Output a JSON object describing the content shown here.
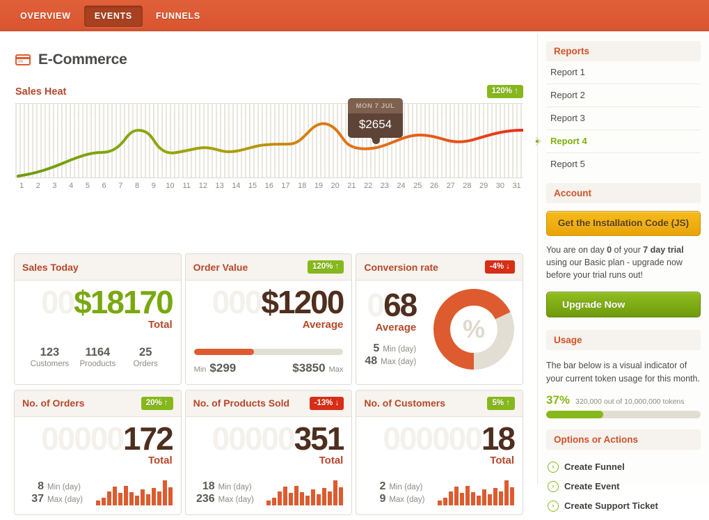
{
  "nav": {
    "tabs": [
      {
        "label": "OVERVIEW",
        "active": false
      },
      {
        "label": "EVENTS",
        "active": true
      },
      {
        "label": "FUNNELS",
        "active": false
      }
    ]
  },
  "page": {
    "title": "E-Commerce",
    "icon": "credit-card-icon"
  },
  "chart_data": {
    "type": "line",
    "title": "Sales Heat",
    "badge": {
      "text": "120% ↑",
      "direction": "up",
      "color": "#86b81b"
    },
    "xlabel": "",
    "ylabel": "",
    "grid": true,
    "legend": "none",
    "categories": [
      "1",
      "2",
      "3",
      "4",
      "5",
      "6",
      "7",
      "8",
      "9",
      "10",
      "11",
      "12",
      "13",
      "14",
      "15",
      "16",
      "17",
      "18",
      "19",
      "20",
      "21",
      "22",
      "23",
      "24",
      "25",
      "26",
      "27",
      "28",
      "29",
      "30",
      "31"
    ],
    "series": [
      {
        "name": "Sales Heat",
        "values": [
          150,
          380,
          640,
          900,
          1150,
          1400,
          1900,
          2300,
          1550,
          1700,
          1900,
          2050,
          1850,
          1900,
          1950,
          2000,
          2100,
          2400,
          3150,
          2450,
          2800,
          2654,
          2900,
          3250,
          3150,
          3000,
          3050,
          3200,
          3300,
          3350,
          3300
        ]
      }
    ],
    "tooltip": {
      "date": "MON 7 JUL",
      "value": "$2654",
      "x_index": 22
    },
    "line_gradient": [
      "#6f9a0d",
      "#a8a50c",
      "#e07b10",
      "#e8571a",
      "#e8231a"
    ]
  },
  "cards": [
    {
      "name": "sales-today",
      "title": "Sales Today",
      "badge": null,
      "ghost": "00",
      "value": "$18170",
      "value_color": "green",
      "value_label": "Total",
      "layout": "stat3",
      "stats": [
        {
          "n": "123",
          "l": "Customers"
        },
        {
          "n": "1164",
          "l": "Prooducts"
        },
        {
          "n": "25",
          "l": "Orders"
        }
      ]
    },
    {
      "name": "order-value",
      "title": "Order Value",
      "badge": {
        "text": "120% ↑",
        "direction": "up"
      },
      "ghost": "000",
      "value": "$1200",
      "value_color": "brown",
      "value_label": "Average",
      "layout": "progress",
      "progress_pct": 40,
      "min_label": "Min",
      "min_value": "$299",
      "max_value": "$3850",
      "max_label": "Max"
    },
    {
      "name": "conversion-rate",
      "title": "Conversion rate",
      "badge": {
        "text": "-4% ↓",
        "direction": "down"
      },
      "ghost": "0",
      "value": "68",
      "value_color": "brown",
      "value_label": "Average",
      "layout": "donut",
      "donut_pct": 68,
      "donut_symbol": "%",
      "min_value": "5",
      "min_label": "Min (day)",
      "max_value": "48",
      "max_label": "Max (day)"
    },
    {
      "name": "no-of-orders",
      "title": "No. of Orders",
      "badge": {
        "text": "20% ↑",
        "direction": "up"
      },
      "ghost": "00000",
      "value": "172",
      "value_color": "brown",
      "value_label": "Total",
      "layout": "spark",
      "min_value": "8",
      "min_label": "Min (day)",
      "max_value": "37",
      "max_label": "Max (day)",
      "spark": [
        20,
        30,
        55,
        75,
        50,
        78,
        52,
        38,
        65,
        45,
        70,
        55,
        100,
        72
      ]
    },
    {
      "name": "no-of-products-sold",
      "title": "No. of Products Sold",
      "badge": {
        "text": "-13% ↓",
        "direction": "down"
      },
      "ghost": "00000",
      "value": "351",
      "value_color": "brown",
      "value_label": "Total",
      "layout": "spark",
      "min_value": "18",
      "min_label": "Min (day)",
      "max_value": "236",
      "max_label": "Max (day)",
      "spark": [
        20,
        30,
        55,
        75,
        50,
        78,
        52,
        38,
        65,
        45,
        70,
        55,
        100,
        72
      ]
    },
    {
      "name": "no-of-customers",
      "title": "No. of Customers",
      "badge": {
        "text": "5% ↑",
        "direction": "up"
      },
      "ghost": "000000",
      "value": "18",
      "value_color": "brown",
      "value_label": "Total",
      "layout": "spark",
      "min_value": "2",
      "min_label": "Min (day)",
      "max_value": "9",
      "max_label": "Max (day)",
      "spark": [
        20,
        30,
        55,
        75,
        50,
        78,
        52,
        38,
        65,
        45,
        70,
        55,
        100,
        72
      ]
    }
  ],
  "sidebar": {
    "reports": {
      "heading": "Reports",
      "items": [
        {
          "label": "Report 1",
          "active": false
        },
        {
          "label": "Report 2",
          "active": false
        },
        {
          "label": "Report 3",
          "active": false
        },
        {
          "label": "Report 4",
          "active": true
        },
        {
          "label": "Report 5",
          "active": false
        }
      ]
    },
    "account": {
      "heading": "Account",
      "install_button": "Get the Installation Code (JS)",
      "trial_text_1": "You are on day ",
      "trial_day": "0",
      "trial_text_2": " of your ",
      "trial_plan": "7 day trial",
      "trial_text_3": " using our Basic plan - upgrade now before your trial runs out!",
      "upgrade_button": "Upgrade Now"
    },
    "usage": {
      "heading": "Usage",
      "description": "The bar below is a visual indicator of your current token usage for this month.",
      "percent_label": "37%",
      "percent": 37,
      "detail": "320,000 out of 10,000,000 tokens"
    },
    "actions": {
      "heading": "Options or Actions",
      "items": [
        {
          "label": "Create Funnel",
          "icon": "chevron-right-circle-icon"
        },
        {
          "label": "Create Event",
          "icon": "chevron-right-circle-icon"
        },
        {
          "label": "Create Support Ticket",
          "icon": "chevron-right-circle-icon"
        }
      ]
    }
  }
}
